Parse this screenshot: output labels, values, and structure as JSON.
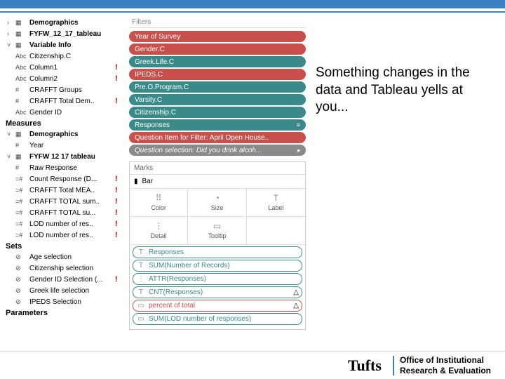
{
  "annotation": "Something changes in the data and Tableau yells at you...",
  "footer": {
    "logo": "Tufts",
    "line1": "Office of Institutional",
    "line2": "Research & Evaluation"
  },
  "left": {
    "top": [
      {
        "chev": "›",
        "icon": "▦",
        "label": "Demographics",
        "bold": true,
        "alert": false
      },
      {
        "chev": "›",
        "icon": "▦",
        "label": "FYFW_12_17_tableau",
        "bold": true,
        "alert": false
      },
      {
        "chev": "˅",
        "icon": "▦",
        "label": "Variable Info",
        "bold": true,
        "alert": false
      },
      {
        "chev": "",
        "icon": "Abc",
        "label": "Citizenship.C",
        "bold": false,
        "alert": false
      },
      {
        "chev": "",
        "icon": "Abc",
        "label": "Column1",
        "bold": false,
        "alert": true
      },
      {
        "chev": "",
        "icon": "Abc",
        "label": "Column2",
        "bold": false,
        "alert": true
      },
      {
        "chev": "",
        "icon": "#",
        "label": "CRAFFT Groups",
        "bold": false,
        "alert": false
      },
      {
        "chev": "",
        "icon": "#",
        "label": "CRAFFT Total Dem..",
        "bold": false,
        "alert": true
      },
      {
        "chev": "",
        "icon": "Abc",
        "label": "Gender ID",
        "bold": false,
        "alert": false
      }
    ],
    "measuresHead": "Measures",
    "measures": [
      {
        "chev": "˅",
        "icon": "▦",
        "label": "Demographics",
        "bold": true,
        "alert": false
      },
      {
        "chev": "",
        "icon": "#",
        "label": "Year",
        "bold": false,
        "alert": false
      },
      {
        "chev": "˅",
        "icon": "▦",
        "label": "FYFW 12 17 tableau",
        "bold": true,
        "alert": false
      },
      {
        "chev": "",
        "icon": "#",
        "label": "Raw Response",
        "bold": false,
        "alert": false
      },
      {
        "chev": "",
        "icon": "=#",
        "label": "Count Response (D...",
        "bold": false,
        "alert": true
      },
      {
        "chev": "",
        "icon": "=#",
        "label": "CRAFFT Total MEA..",
        "bold": false,
        "alert": true
      },
      {
        "chev": "",
        "icon": "=#",
        "label": "CRAFFT TOTAL sum..",
        "bold": false,
        "alert": true
      },
      {
        "chev": "",
        "icon": "=#",
        "label": "CRAFFT TOTAL su...",
        "bold": false,
        "alert": true
      },
      {
        "chev": "",
        "icon": "=#",
        "label": "LOD number of res..",
        "bold": false,
        "alert": true
      },
      {
        "chev": "",
        "icon": "=#",
        "label": "LOD number of res..",
        "bold": false,
        "alert": true
      }
    ],
    "setsHead": "Sets",
    "sets": [
      {
        "icon": "⊘",
        "label": "Age selection"
      },
      {
        "icon": "⊘",
        "label": "Citizenship selection"
      },
      {
        "icon": "⊘",
        "label": "Gender ID Selection (...",
        "alert": true
      },
      {
        "icon": "⊘",
        "label": "Greek life selection"
      },
      {
        "icon": "⊘",
        "label": "IPEDS Selection"
      }
    ],
    "paramsHead": "Parameters"
  },
  "filters": {
    "head": "Filters",
    "pills": [
      {
        "label": "Year of Survey",
        "cls": "red"
      },
      {
        "label": "Gender.C",
        "cls": "red"
      },
      {
        "label": "Greek.Life.C",
        "cls": "teal"
      },
      {
        "label": "IPEDS.C",
        "cls": "red"
      },
      {
        "label": "Pre.O.Program.C",
        "cls": "teal"
      },
      {
        "label": "Varsity.C",
        "cls": "teal"
      },
      {
        "label": "Citizenship.C",
        "cls": "teal"
      },
      {
        "label": "Responses",
        "cls": "teal",
        "icon": "≡"
      },
      {
        "label": "Question Item for Filter: April Open House..",
        "cls": "red"
      },
      {
        "label": "Question selection: Did you drink alcoh...",
        "cls": "gray",
        "icon": "▸"
      }
    ]
  },
  "marks": {
    "head": "Marks",
    "type": "Bar",
    "typeIcon": "▮",
    "cells": [
      {
        "icon": "⠿",
        "label": "Color"
      },
      {
        "icon": "◔",
        "label": "Size"
      },
      {
        "icon": "T",
        "label": "Label"
      },
      {
        "icon": "⋮",
        "label": "Detail"
      },
      {
        "icon": "▭",
        "label": "Tooltip"
      },
      {
        "icon": "",
        "label": ""
      }
    ],
    "shelf": [
      {
        "slot": "T",
        "label": "Responses",
        "cls": ""
      },
      {
        "slot": "T",
        "label": "SUM(Number of Records)",
        "cls": ""
      },
      {
        "slot": "⋮",
        "label": "ATTR(Responses)",
        "cls": ""
      },
      {
        "slot": "T",
        "label": "CNT(Responses)",
        "cls": "",
        "warn": true
      },
      {
        "slot": "▭",
        "label": "percent of total",
        "cls": "red-b",
        "warn": true
      },
      {
        "slot": "▭",
        "label": "SUM(LOD number of responses)",
        "cls": ""
      }
    ]
  }
}
